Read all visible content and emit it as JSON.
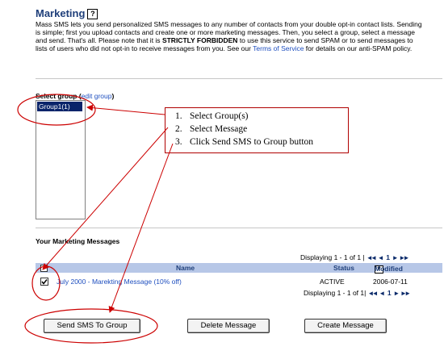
{
  "header": {
    "title": "Marketing",
    "help_icon": "?"
  },
  "intro": {
    "text_1": "Mass SMS lets you send personalized SMS messages to any number of contacts from your double opt-in contact lists. Sending is simple; first you upload contacts and create one or more marketing messages. Then, you select a group, select a message and send. That's all. Please note that it is ",
    "bold": "STRICTLY FORBIDDEN",
    "text_2": " to use this service to send SPAM or to send messages to lists of users who did not opt-in to receive messages from you. See our ",
    "link": "Terms of Service",
    "text_3": " for details on our anti-SPAM policy."
  },
  "select_group": {
    "label": "Select group (",
    "edit_link": "edit group",
    "label_close": ")",
    "items": [
      "Group1(1)"
    ]
  },
  "callout": {
    "steps": [
      {
        "num": "1.",
        "text": "Select Group(s)"
      },
      {
        "num": "2.",
        "text": "Select Message"
      },
      {
        "num": "3.",
        "text": "Click Send SMS to Group button"
      }
    ]
  },
  "messages": {
    "title": "Your Marketing Messages",
    "displaying_top": "Displaying 1 - 1 of 1 |",
    "displaying_bottom": "Displaying 1 - 1 of 1|",
    "nav": "◂◂ ◂ 1 ▸ ▸▸",
    "columns": {
      "name": "Name",
      "status": "Status",
      "modified": "Modified"
    },
    "sort_icon": "▼",
    "rows": [
      {
        "name": "July 2000 - Marekting Message (10% off)",
        "status": "ACTIVE",
        "modified": "2006-07-11",
        "checked": true
      }
    ]
  },
  "buttons": {
    "send": "Send SMS To Group",
    "delete": "Delete Message",
    "create": "Create Message"
  },
  "colors": {
    "annotation": "#cc0000",
    "header_bg": "#b7c7e7",
    "title": "#1f3f7a",
    "link": "#1f4fbf"
  }
}
